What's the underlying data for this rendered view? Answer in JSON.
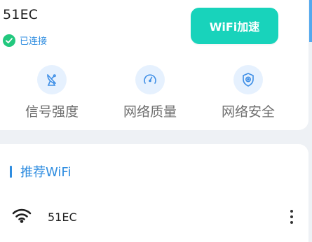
{
  "network": {
    "ssid": "51EC",
    "status": "已连接"
  },
  "actions": {
    "boost_label": "WiFi加速"
  },
  "features": [
    {
      "label": "信号强度",
      "icon": "satellite-dish-icon"
    },
    {
      "label": "网络质量",
      "icon": "speedometer-icon"
    },
    {
      "label": "网络安全",
      "icon": "shield-icon"
    }
  ],
  "recommended": {
    "title": "推荐WiFi",
    "items": [
      {
        "name": "51EC",
        "icon": "wifi-icon"
      }
    ]
  },
  "colors": {
    "accent": "#18d3bb",
    "link": "#2f8de0",
    "success": "#22c87e",
    "icon_bg": "#e6f1fe"
  }
}
